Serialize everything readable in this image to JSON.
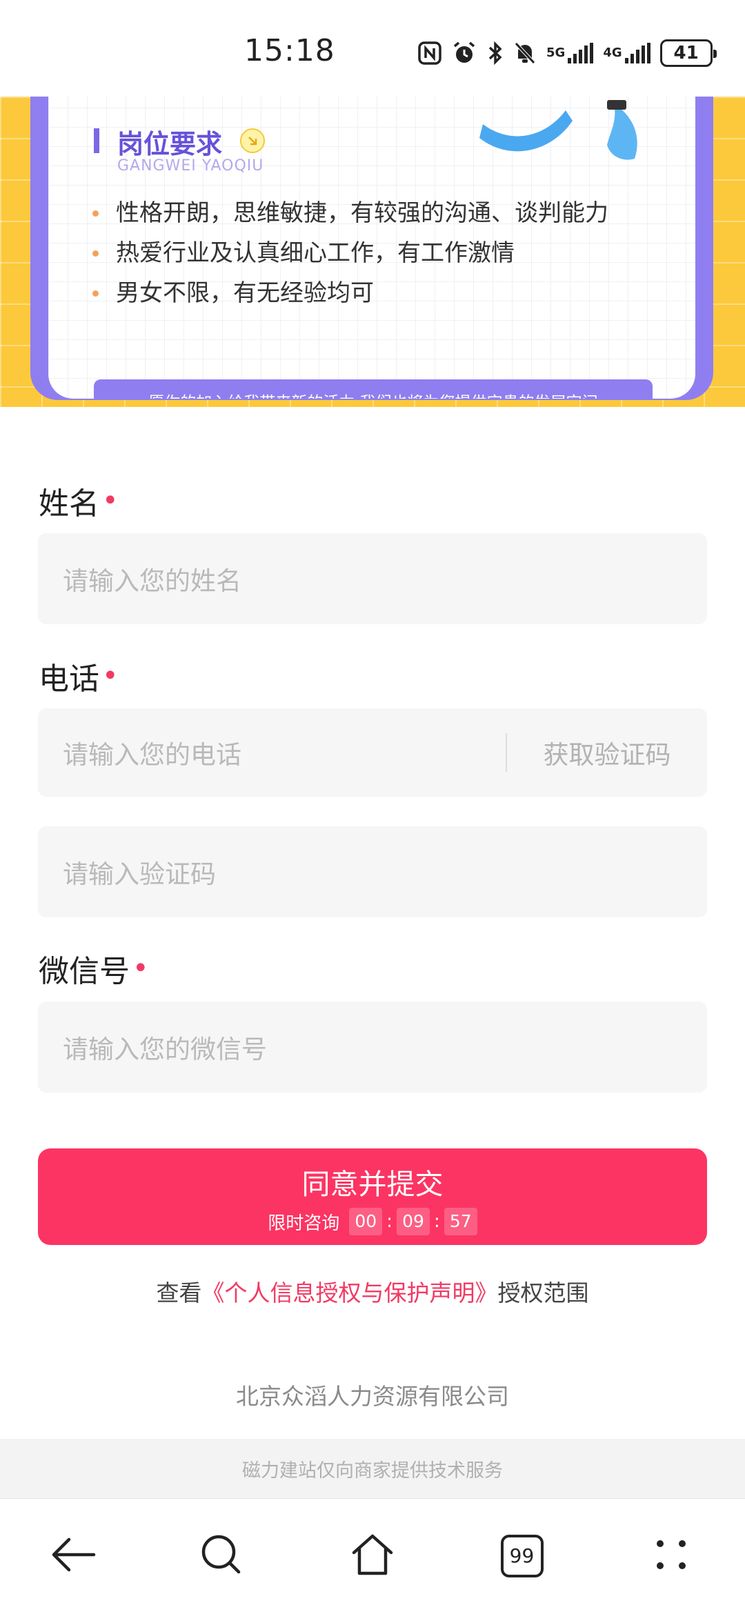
{
  "status_bar": {
    "time": "15:18",
    "network_5g": "5G",
    "network_4g": "4G",
    "battery": "41",
    "icons": [
      "nfc-icon",
      "alarm-icon",
      "bluetooth-icon",
      "mute-icon",
      "signal-icon",
      "battery-icon"
    ]
  },
  "banner": {
    "title": "岗位要求",
    "subtitle": "GANGWEI YAOQIU",
    "requirements": [
      "性格开朗，思维敏捷，有较强的沟通、谈判能力",
      "热爱行业及认真细心工作，有工作激情",
      "男女不限，有无经验均可"
    ],
    "slogan": "— 愿你的加入给我带来新的活力 我们也将为您提供宝贵的发展空间 —",
    "colors": {
      "background": "#fcc93c",
      "frame": "#8f7ef0",
      "title": "#6652d9"
    }
  },
  "form": {
    "name": {
      "label": "姓名",
      "placeholder": "请输入您的姓名"
    },
    "phone": {
      "label": "电话",
      "placeholder": "请输入您的电话",
      "code_button": "获取验证码"
    },
    "code": {
      "placeholder": "请输入验证码"
    },
    "wechat": {
      "label": "微信号",
      "placeholder": "请输入您的微信号"
    },
    "required_mark": "•"
  },
  "submit": {
    "label": "同意并提交",
    "countdown_label": "限时咨询",
    "countdown": {
      "hours": "00",
      "minutes": "09",
      "seconds": "57"
    },
    "color": "#fc3463"
  },
  "privacy": {
    "prefix": "查看",
    "link": "《个人信息授权与保护声明》",
    "suffix": "授权范围"
  },
  "company": "北京众滔人力资源有限公司",
  "footer": "磁力建站仅向商家提供技术服务",
  "bottom_nav": {
    "tabs_count": "99",
    "icons": [
      "back-icon",
      "search-icon",
      "home-icon",
      "tabs-icon",
      "more-icon"
    ]
  }
}
